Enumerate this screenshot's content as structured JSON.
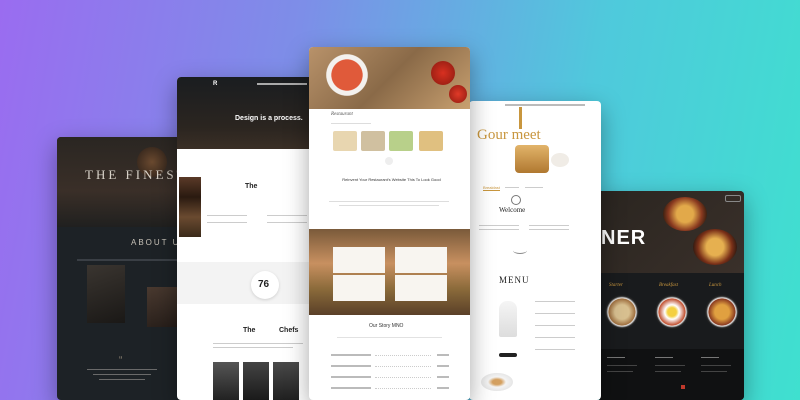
{
  "card1": {
    "hero_title": "THE FINEST",
    "section_title": "ABOUT US",
    "quote_mark": "“"
  },
  "card2": {
    "logo": "R",
    "hero_heading": "Design is a process.",
    "section_title": "The",
    "stat_number": "76",
    "chefs_title_left": "The",
    "chefs_title_right": "Chefs"
  },
  "card3": {
    "logo": "Restaurant",
    "headline": "Reinvent Your Restaurant's Website This To Look Good",
    "story_title": "Our Story MNO"
  },
  "card4": {
    "logo": "Gour meet",
    "welcome": "Welcome",
    "menu": "MENU",
    "tab_active": "Breakfast"
  },
  "card5": {
    "hero_text": "NER",
    "categories": [
      "Starter",
      "Breakfast",
      "Lunch"
    ]
  },
  "colors": {
    "accent_gold": "#c8963e",
    "accent_red": "#c0392b"
  }
}
